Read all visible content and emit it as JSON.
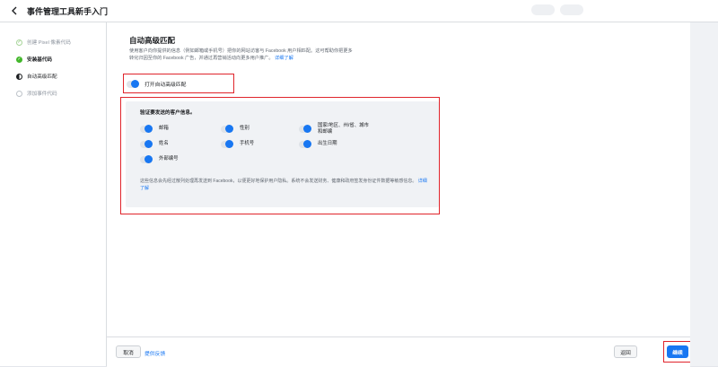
{
  "header": {
    "title": "事件管理工具新手入门",
    "back_icon": "chevron-left-icon"
  },
  "sidebar": {
    "steps": [
      {
        "label": "创建 Pixel 像素代码",
        "state": "done"
      },
      {
        "label": "安装基代码",
        "state": "current"
      },
      {
        "label": "自动高级匹配",
        "state": "in-progress"
      },
      {
        "label": "添加事件代码",
        "state": "todo"
      }
    ]
  },
  "main": {
    "title": "自动高级匹配",
    "description": "使用客户向你提供的信息（例如邮箱或手机号）把你的网站访客与 Facebook 用户相匹配。这可帮助你把更多转化归因至你的 Facebook 广告，并通过再营销活动向更多用户推广。",
    "description_link": "详细了解",
    "toggle_label": "打开自动高级匹配",
    "toggle_on": true,
    "panel": {
      "title": "验证要发送的客户信息。",
      "fields": {
        "email": "邮箱",
        "gender": "性别",
        "location": "国家/地区、州/省、城市和邮编",
        "last_name": "姓名",
        "phone": "手机号",
        "birthdate": "出生日期",
        "external_id": "外部编号"
      },
      "note": "这些信息会先经过散列处理再发送到 Facebook，以便更好地保护用户隐私。系统不会发送财务、健康和政府签发身份证件数据等敏感信息。",
      "note_link": "详细了解"
    }
  },
  "footer": {
    "cancel": "取消",
    "feedback": "提供反馈",
    "back": "返回",
    "continue": "继续"
  },
  "colors": {
    "accent": "#1877f2",
    "highlight": "#e0242b",
    "success": "#42b72a"
  }
}
